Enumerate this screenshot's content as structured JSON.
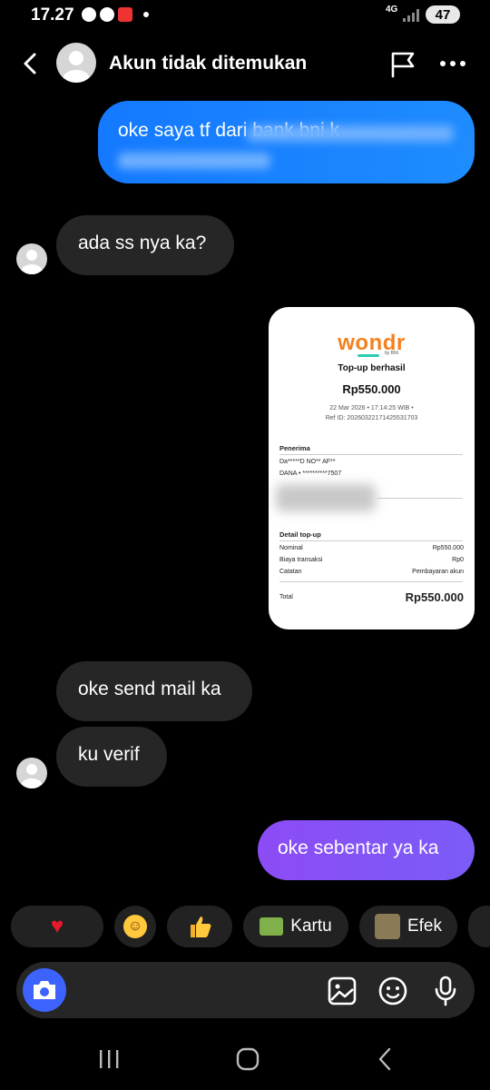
{
  "status_bar": {
    "time": "17.27",
    "network": "4G",
    "battery": "47"
  },
  "header": {
    "title": "Akun tidak ditemukan"
  },
  "messages": [
    {
      "from": "me",
      "text": "oke saya tf dari bank bni k"
    },
    {
      "from": "them",
      "text": "ada ss nya ka?"
    },
    {
      "from": "them",
      "text": "oke send mail ka"
    },
    {
      "from": "them",
      "text": "ku verif"
    },
    {
      "from": "me",
      "text": "oke sebentar ya ka"
    }
  ],
  "receipt": {
    "brand": "wondr",
    "brand_sub": "by BNI",
    "status": "Top-up berhasil",
    "amount": "Rp550.000",
    "datetime": "22 Mar 2026 • 17:14:25 WIB •",
    "ref": "Ref ID: 20260322171425531703",
    "penerima_title": "Penerima",
    "penerima_name": "Da*****D NO** AF**",
    "penerima_account": "DANA • **********7507",
    "detail_title": "Detail top-up",
    "rows": [
      {
        "label": "Nominal",
        "value": "Rp550.000"
      },
      {
        "label": "Biaya transaksi",
        "value": "Rp0"
      },
      {
        "label": "Catatan",
        "value": "Pembayaran akun"
      }
    ],
    "total_label": "Total",
    "total_value": "Rp550.000"
  },
  "reactions": [
    {
      "icon": "heart-emoji",
      "label": ""
    },
    {
      "icon": "laughing-emoji",
      "label": ""
    },
    {
      "icon": "thumbs-up-emoji",
      "label": ""
    },
    {
      "icon": "card-icon",
      "label": "Kartu"
    },
    {
      "icon": "effect-icon",
      "label": "Efek"
    }
  ],
  "colors": {
    "outgoing_blue": "#1479ff",
    "outgoing_purple": "#8c4bf6",
    "incoming": "#262626",
    "camera_button": "#3d63ff",
    "wondr_orange": "#f3821f"
  }
}
